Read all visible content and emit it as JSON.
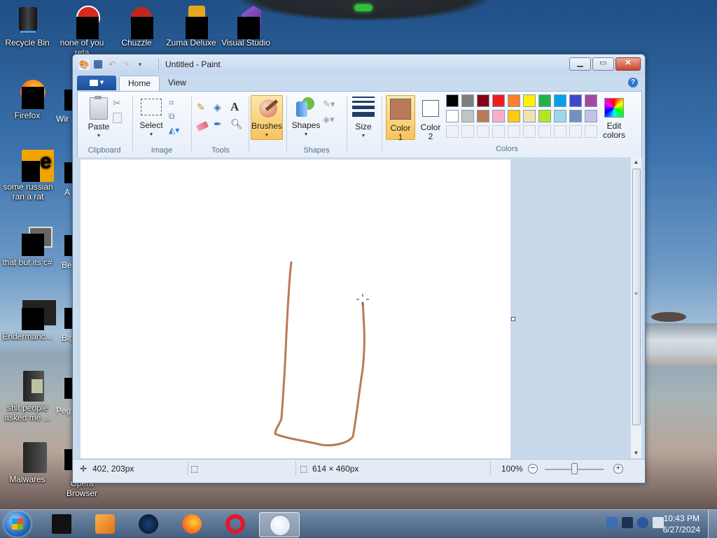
{
  "desktop": {
    "icons": [
      {
        "label": "Recycle Bin"
      },
      {
        "label": "none of you reta"
      },
      {
        "label": "Chuzzle"
      },
      {
        "label": "Zuma Deluxe"
      },
      {
        "label": "Visual Studio"
      },
      {
        "label": "Firefox"
      },
      {
        "label": "some russian ran a rat"
      },
      {
        "label": "that but its c#"
      },
      {
        "label": "Endermanc..."
      },
      {
        "label": "shit people asked me ..."
      },
      {
        "label": "Malwares"
      },
      {
        "label": "Opera Browser"
      }
    ],
    "partial_labels": [
      "Wir",
      "A",
      "Be",
      "Big",
      "Peg"
    ]
  },
  "paint": {
    "title": "Untitled - Paint",
    "tabs": {
      "file": "▾",
      "home": "Home",
      "view": "View"
    },
    "groups": {
      "clipboard": "Clipboard",
      "image": "Image",
      "tools": "Tools",
      "shapes": "Shapes",
      "colors": "Colors"
    },
    "buttons": {
      "paste": "Paste",
      "select": "Select",
      "brushes": "Brushes",
      "shapes": "Shapes",
      "size": "Size",
      "color1": "Color 1",
      "color2": "Color 2",
      "edit_colors": "Edit colors"
    },
    "palette_row1": [
      "#000000",
      "#7f7f7f",
      "#880015",
      "#ed1c24",
      "#ff7f27",
      "#fff200",
      "#22b14c",
      "#00a2e8",
      "#3f48cc",
      "#a349a4"
    ],
    "palette_row2": [
      "#ffffff",
      "#c3c3c3",
      "#b97a57",
      "#ffaec9",
      "#ffc90e",
      "#efe4b0",
      "#b5e61d",
      "#99d9ea",
      "#7092be",
      "#c8bfe7"
    ],
    "color1_value": "#b97a57",
    "color2_value": "#ffffff",
    "status": {
      "cursor_pos": "402, 203px",
      "canvas_size": "614 × 460px",
      "zoom": "100%"
    }
  },
  "taskbar": {
    "time": "10:43 PM",
    "date": "6/27/2024"
  }
}
